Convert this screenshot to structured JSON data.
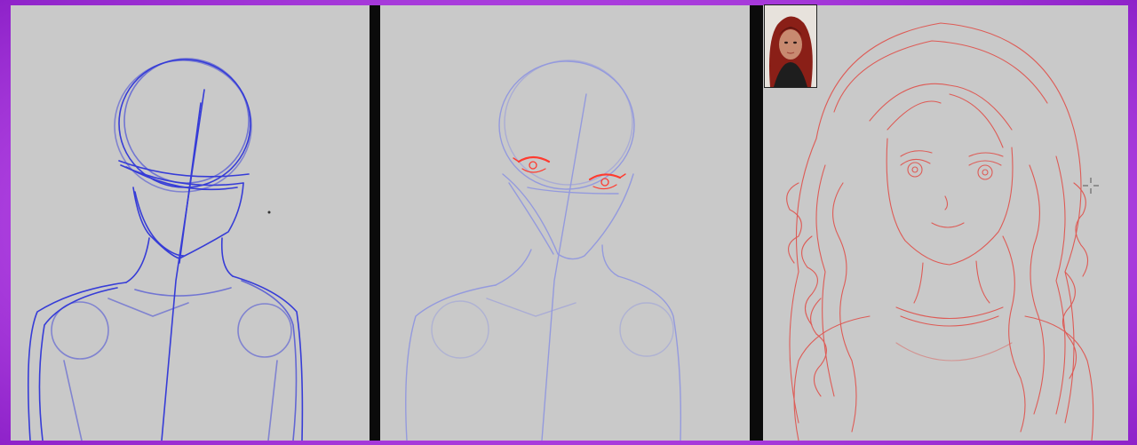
{
  "panels": [
    {
      "name": "step-1",
      "stroke_color": "#2f35d8"
    },
    {
      "name": "step-2",
      "stroke_color": "#8f95e0",
      "accent_color": "#ff3b2f"
    },
    {
      "name": "step-3",
      "stroke_color": "#e0504a"
    }
  ],
  "colors": {
    "frame": "#b04ae0",
    "canvas": "#c9c9c9",
    "divider": "#0b0b0b"
  },
  "overlay": {
    "webcam_icon": "person-camera-icon",
    "cursor_icon": "crosshair-cursor-icon"
  }
}
